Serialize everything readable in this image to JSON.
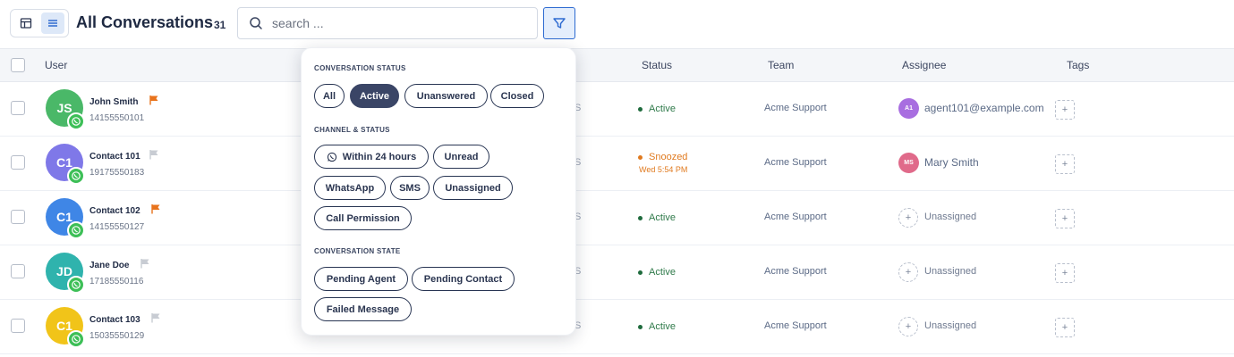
{
  "header": {
    "title": "All Conversations",
    "count": "31",
    "search_placeholder": "search ..."
  },
  "table": {
    "columns": [
      "User",
      "Status",
      "Team",
      "Assignee",
      "Tags"
    ],
    "rows": [
      {
        "initials": "JS",
        "avatar_color": "#4ab868",
        "name": "John Smith",
        "flag": "orange",
        "phone": "14155550101",
        "status": "Active",
        "status_type": "active",
        "status_sub": "",
        "team": "Acme Support",
        "assignee_initials": "A1",
        "assignee_color": "#a86ee0",
        "assignee": "agent101@example.com"
      },
      {
        "initials": "C1",
        "avatar_color": "#7f78e8",
        "name": "Contact 101",
        "flag": "gray",
        "phone": "19175550183",
        "status": "Snoozed",
        "status_type": "snoozed",
        "status_sub": "Wed 5:54 PM",
        "team": "Acme Support",
        "assignee_initials": "MS",
        "assignee_color": "#e06a8a",
        "assignee": "Mary Smith"
      },
      {
        "initials": "C1",
        "avatar_color": "#3f86e6",
        "name": "Contact 102",
        "flag": "orange",
        "phone": "14155550127",
        "status": "Active",
        "status_type": "active",
        "status_sub": "",
        "team": "Acme Support",
        "assignee_initials": "",
        "assignee_color": "",
        "assignee": "Unassigned"
      },
      {
        "initials": "JD",
        "avatar_color": "#2fb3ad",
        "name": "Jane Doe",
        "flag": "gray",
        "phone": "17185550116",
        "status": "Active",
        "status_type": "active",
        "status_sub": "",
        "team": "Acme Support",
        "assignee_initials": "",
        "assignee_color": "",
        "assignee": "Unassigned"
      },
      {
        "initials": "C1",
        "avatar_color": "#f1c419",
        "name": "Contact 103",
        "flag": "gray",
        "phone": "15035550129",
        "status": "Active",
        "status_type": "active",
        "status_sub": "",
        "team": "Acme Support",
        "assignee_initials": "",
        "assignee_color": "",
        "assignee": "Unassigned"
      }
    ],
    "hidden_column_glyph": "S"
  },
  "filter": {
    "sections": {
      "status": "CONVERSATION STATUS",
      "channel": "CHANNEL & STATUS",
      "state": "CONVERSATION STATE"
    },
    "status_chips": [
      "All",
      "Active",
      "Unanswered",
      "Closed"
    ],
    "active_status": "Active",
    "channel_chips": [
      "Within 24 hours",
      "Unread",
      "WhatsApp",
      "SMS",
      "Unassigned",
      "Call Permission"
    ],
    "state_chips": [
      "Pending Agent",
      "Pending Contact",
      "Failed Message"
    ]
  },
  "colors": {
    "accent": "#2e6bd1",
    "active_status": "#1f6b3d",
    "snoozed_status": "#e07a1f",
    "flag_orange": "#e8731c",
    "flag_gray": "#c8ccd3",
    "whatsapp": "#3dbf57"
  },
  "icons": [
    "table-view-icon",
    "list-view-icon",
    "search-icon",
    "filter-icon",
    "flag-icon",
    "whatsapp-icon",
    "plus-icon"
  ]
}
